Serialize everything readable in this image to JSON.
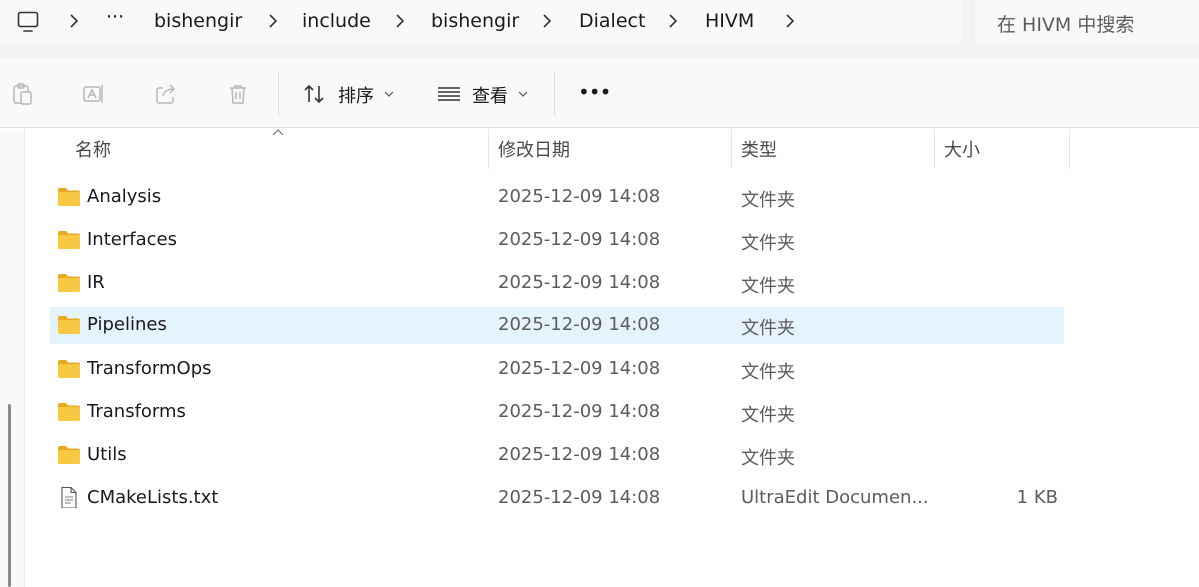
{
  "address_bar": {
    "overflow": "···",
    "crumbs": [
      "bishengir",
      "include",
      "bishengir",
      "Dialect",
      "HIVM"
    ]
  },
  "search": {
    "placeholder": "在 HIVM 中搜索"
  },
  "toolbar": {
    "sort_label": "排序",
    "view_label": "查看",
    "more": "•••"
  },
  "columns": {
    "name": "名称",
    "modified": "修改日期",
    "type": "类型",
    "size": "大小"
  },
  "files": [
    {
      "name": "Analysis",
      "modified": "2025-12-09 14:08",
      "type": "文件夹",
      "size": "",
      "kind": "folder"
    },
    {
      "name": "Interfaces",
      "modified": "2025-12-09 14:08",
      "type": "文件夹",
      "size": "",
      "kind": "folder"
    },
    {
      "name": "IR",
      "modified": "2025-12-09 14:08",
      "type": "文件夹",
      "size": "",
      "kind": "folder"
    },
    {
      "name": "Pipelines",
      "modified": "2025-12-09 14:08",
      "type": "文件夹",
      "size": "",
      "kind": "folder",
      "selected": true
    },
    {
      "name": "TransformOps",
      "modified": "2025-12-09 14:08",
      "type": "文件夹",
      "size": "",
      "kind": "folder"
    },
    {
      "name": "Transforms",
      "modified": "2025-12-09 14:08",
      "type": "文件夹",
      "size": "",
      "kind": "folder"
    },
    {
      "name": "Utils",
      "modified": "2025-12-09 14:08",
      "type": "文件夹",
      "size": "",
      "kind": "folder"
    },
    {
      "name": "CMakeLists.txt",
      "modified": "2025-12-09 14:08",
      "type": "UltraEdit Documen...",
      "size": "1 KB",
      "kind": "file"
    }
  ],
  "colors": {
    "folder_fill": "#f8c842",
    "folder_back": "#e8a820",
    "selection": "#e5f3fd",
    "accent": "#0067c0"
  }
}
